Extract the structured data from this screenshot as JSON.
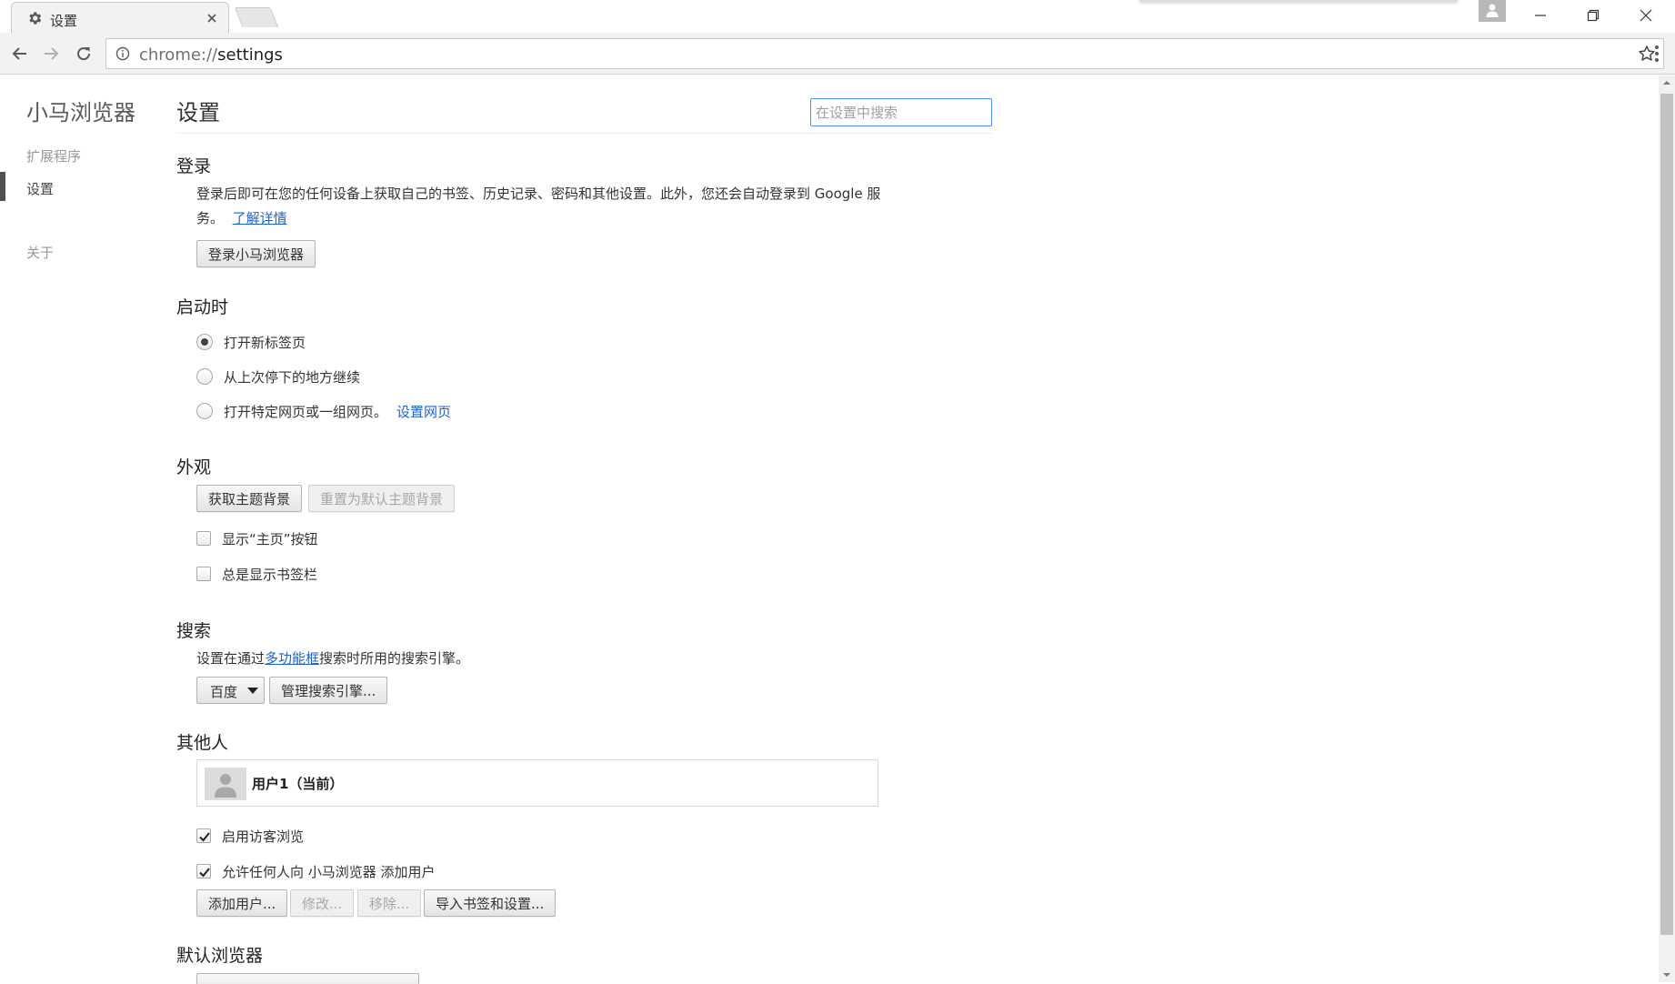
{
  "window": {
    "tab_title": "设置",
    "tab_icon": "gear-icon",
    "url_scheme": "chrome://",
    "url_host": "settings"
  },
  "sidebar": {
    "brand": "小马浏览器",
    "items": [
      {
        "label": "扩展程序"
      },
      {
        "label": "设置"
      },
      {
        "label": "关于"
      }
    ],
    "selected_index": 1
  },
  "header": {
    "title": "设置",
    "search_placeholder": "在设置中搜索"
  },
  "signin": {
    "title": "登录",
    "description_line1": "登录后即可在您的任何设备上获取自己的书签、历史记录、密码和其他设置。此外，您还会自动登录到 Google 服",
    "description_line2": "务。",
    "learn_more": "了解详情",
    "button": "登录小马浏览器"
  },
  "startup": {
    "title": "启动时",
    "options": [
      {
        "label": "打开新标签页",
        "checked": true
      },
      {
        "label": "从上次停下的地方继续",
        "checked": false
      },
      {
        "label": "打开特定网页或一组网页。",
        "checked": false
      }
    ],
    "set_pages_link": "设置网页"
  },
  "appearance": {
    "title": "外观",
    "get_themes": "获取主题背景",
    "reset_theme": "重置为默认主题背景",
    "show_home_button": {
      "label": "显示“主页”按钮",
      "checked": false
    },
    "show_bookmarks_bar": {
      "label": "总是显示书签栏",
      "checked": false
    }
  },
  "search": {
    "title": "搜索",
    "description_prefix": "设置在通过",
    "description_link": "多功能框",
    "description_suffix": "搜索时所用的搜索引擎。",
    "engine_selected": "百度",
    "manage_button": "管理搜索引擎..."
  },
  "people": {
    "title": "其他人",
    "users": [
      {
        "name": "用户1（当前）"
      }
    ],
    "enable_guest": {
      "label": "启用访客浏览",
      "checked": true
    },
    "allow_add_user": {
      "label": "允许任何人向 小马浏览器 添加用户",
      "checked": true
    },
    "add_user": "添加用户...",
    "edit": "修改...",
    "remove": "移除...",
    "import": "导入书签和设置..."
  },
  "default_browser": {
    "title": "默认浏览器"
  },
  "colors": {
    "link": "#1f63cc",
    "focus_border": "#4d90fe",
    "nav_selected": "#4e5051"
  }
}
